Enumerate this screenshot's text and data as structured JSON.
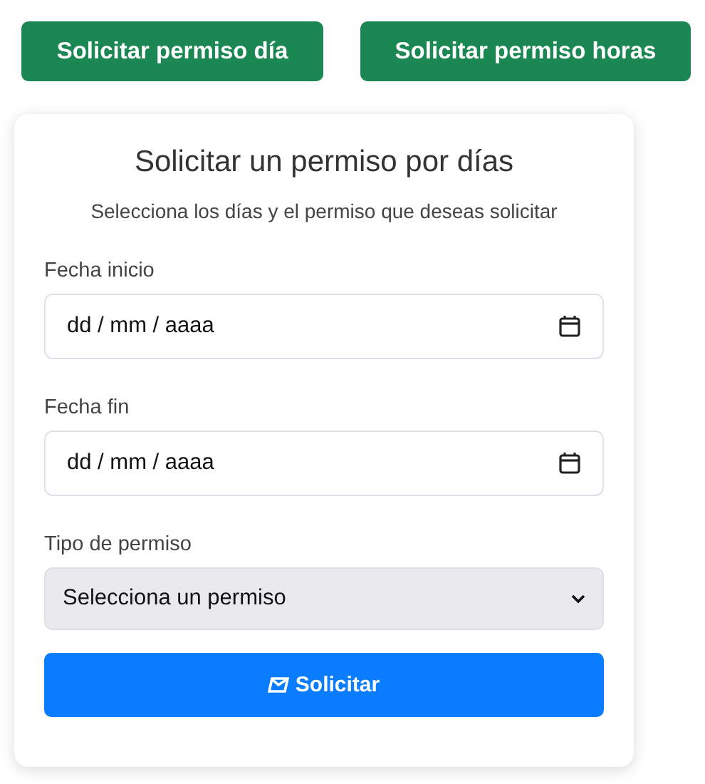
{
  "top_buttons": [
    {
      "label": "Solicitar permiso día"
    },
    {
      "label": "Solicitar permiso horas"
    }
  ],
  "card": {
    "title": "Solicitar un permiso por días",
    "subtitle": "Selecciona los días y el permiso que deseas solicitar",
    "fields": [
      {
        "kind": "date",
        "label": "Fecha inicio",
        "placeholder": "dd / mm / aaaa"
      },
      {
        "kind": "date",
        "label": "Fecha fin",
        "placeholder": "dd / mm / aaaa"
      },
      {
        "kind": "select",
        "label": "Tipo de permiso",
        "value": "Selecciona un permiso"
      }
    ],
    "submit_button": {
      "label": "Solicitar"
    }
  }
}
